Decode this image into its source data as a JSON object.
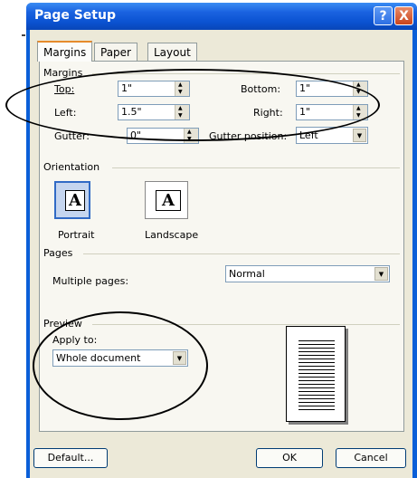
{
  "window": {
    "title": "Page Setup"
  },
  "titlebar_buttons": {
    "help": "?",
    "close": "X"
  },
  "tabs": [
    {
      "label": "Margins"
    },
    {
      "label": "Paper"
    },
    {
      "label": "Layout"
    }
  ],
  "margins": {
    "group_label": "Margins",
    "top": {
      "label": "Top:",
      "value": "1\""
    },
    "bottom": {
      "label": "Bottom:",
      "value": "1\""
    },
    "left": {
      "label": "Left:",
      "value": "1.5\""
    },
    "right": {
      "label": "Right:",
      "value": "1\""
    },
    "gutter": {
      "label": "Gutter:",
      "value": "0\""
    },
    "gutter_position": {
      "label": "Gutter position:",
      "value": "Left"
    }
  },
  "orientation": {
    "group_label": "Orientation",
    "glyph": "A",
    "portrait_label": "Portrait",
    "landscape_label": "Landscape"
  },
  "pages": {
    "group_label": "Pages",
    "multiple_pages_label": "Multiple pages:",
    "multiple_pages_value": "Normal"
  },
  "preview": {
    "group_label": "Preview",
    "apply_to_label": "Apply to:",
    "apply_to_value": "Whole document"
  },
  "buttons": {
    "default": "Default...",
    "ok": "OK",
    "cancel": "Cancel"
  }
}
